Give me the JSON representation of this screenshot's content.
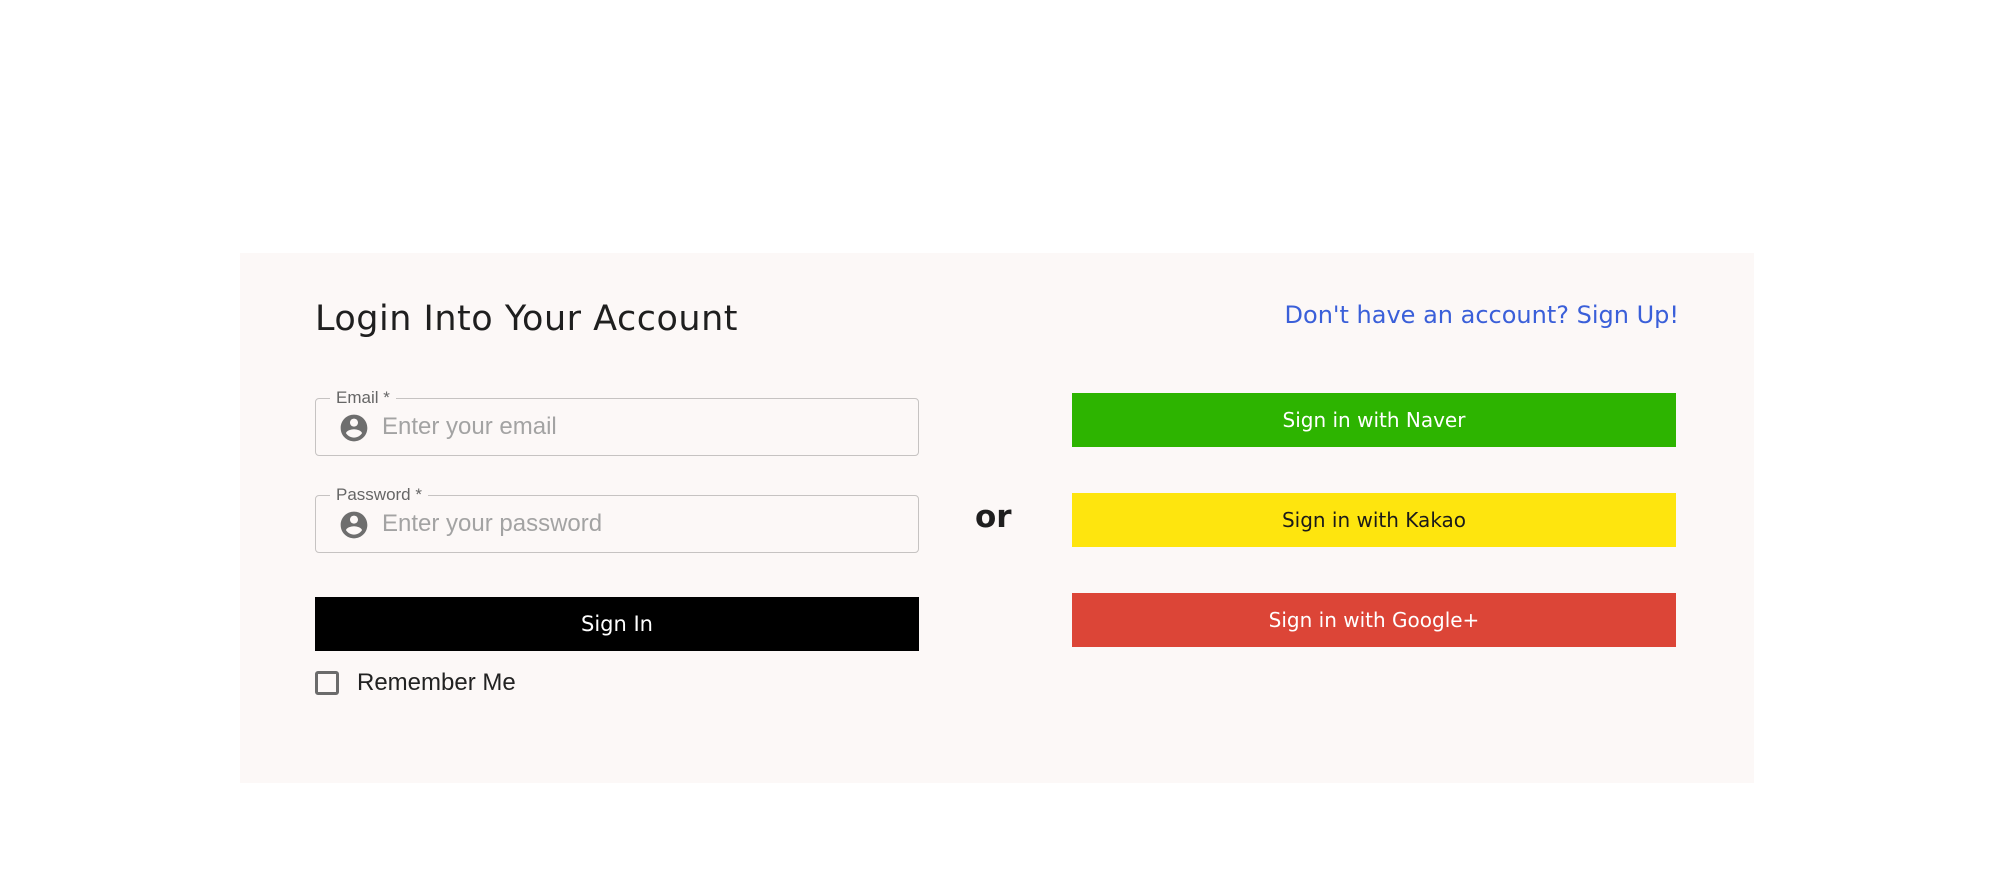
{
  "login": {
    "title": "Login Into Your Account",
    "signup_link": "Don't have an account? Sign Up!",
    "email": {
      "label": "Email *",
      "placeholder": "Enter your email",
      "icon": "account-circle-icon"
    },
    "password": {
      "label": "Password *",
      "placeholder": "Enter your password",
      "icon": "account-circle-icon"
    },
    "signin_label": "Sign In",
    "remember_label": "Remember Me",
    "remember_checked": false,
    "or_label": "or"
  },
  "social": {
    "naver": {
      "label": "Sign in with Naver",
      "bg": "#2db400",
      "fg": "#ffffff"
    },
    "kakao": {
      "label": "Sign in with Kakao",
      "bg": "#fee50e",
      "fg": "#1a1a1a"
    },
    "google": {
      "label": "Sign in with Google+",
      "bg": "#dc4537",
      "fg": "#ffffff"
    }
  },
  "colors": {
    "card_bg": "#fcf8f7",
    "link": "#3a5fd9",
    "primary_button": "#000000"
  }
}
